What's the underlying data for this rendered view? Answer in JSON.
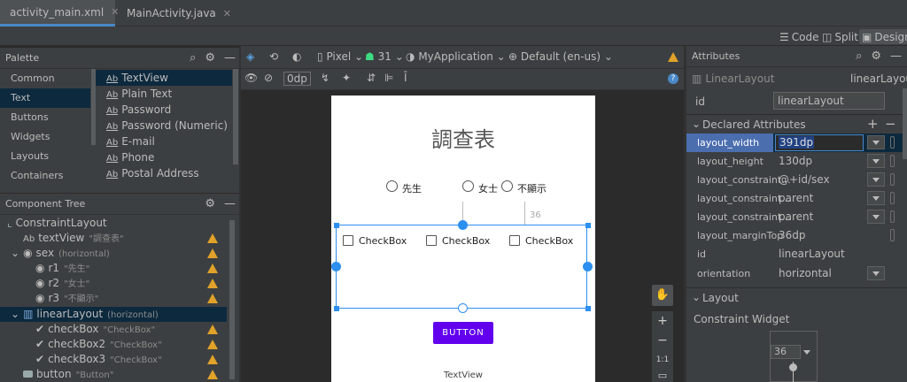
{
  "editor_tabs": [
    {
      "label": "activity_main.xml",
      "active": true
    },
    {
      "label": "MainActivity.java",
      "active": false
    }
  ],
  "modes": {
    "code": "Code",
    "split": "Split",
    "design": "Design"
  },
  "palette": {
    "title": "Palette",
    "categories": [
      "Common",
      "Text",
      "Buttons",
      "Widgets",
      "Layouts",
      "Containers"
    ],
    "selected_category": "Text",
    "items": [
      "TextView",
      "Plain Text",
      "Password",
      "Password (Numeric)",
      "E-mail",
      "Phone",
      "Postal Address"
    ],
    "item_prefix": "Ab"
  },
  "tree": {
    "title": "Component Tree",
    "nodes": [
      {
        "label": "ConstraintLayout",
        "sub": ""
      },
      {
        "label": "textView",
        "sub": "\"調查表\""
      },
      {
        "label": "sex",
        "sub": "(horizontal)"
      },
      {
        "label": "r1",
        "sub": "\"先生\""
      },
      {
        "label": "r2",
        "sub": "\"女士\""
      },
      {
        "label": "r3",
        "sub": "\"不顯示\""
      },
      {
        "label": "linearLayout",
        "sub": "(horizontal)"
      },
      {
        "label": "checkBox",
        "sub": "\"CheckBox\""
      },
      {
        "label": "checkBox2",
        "sub": "\"CheckBox\""
      },
      {
        "label": "checkBox3",
        "sub": "\"CheckBox\""
      },
      {
        "label": "button",
        "sub": "\"Button\""
      }
    ],
    "ab": "Ab"
  },
  "toolbar": {
    "device": "Pixel",
    "api": "31",
    "app": "MyApplication",
    "locale": "Default (en-us)",
    "margin": "0dp"
  },
  "preview": {
    "title": "調查表",
    "radios": [
      "先生",
      "女士",
      "不顯示"
    ],
    "checkboxes": [
      "CheckBox",
      "CheckBox",
      "CheckBox"
    ],
    "button": "BUTTON",
    "footer": "TextView",
    "margin_label": "36"
  },
  "attributes": {
    "title": "Attributes",
    "class": "LinearLayout",
    "class_right": "linearLayout",
    "id_label": "id",
    "id_value": "linearLayout",
    "declared": "Declared Attributes",
    "rows": [
      {
        "name": "layout_width",
        "value": "391dp"
      },
      {
        "name": "layout_height",
        "value": "130dp"
      },
      {
        "name": "layout_constraint...",
        "value": "@+id/sex"
      },
      {
        "name": "layout_constraint...",
        "value": "parent"
      },
      {
        "name": "layout_constraint...",
        "value": "parent"
      },
      {
        "name": "layout_marginTop",
        "value": "36dp"
      },
      {
        "name": "id",
        "value": "linearLayout"
      },
      {
        "name": "orientation",
        "value": "horizontal"
      }
    ],
    "layout": "Layout",
    "constraint_widget": "Constraint Widget",
    "cw_value": "36"
  },
  "colors": {
    "accent": "#4a88c7",
    "selection": "#2d8ff0",
    "button": "#6200ee",
    "warning": "#e0a229"
  }
}
